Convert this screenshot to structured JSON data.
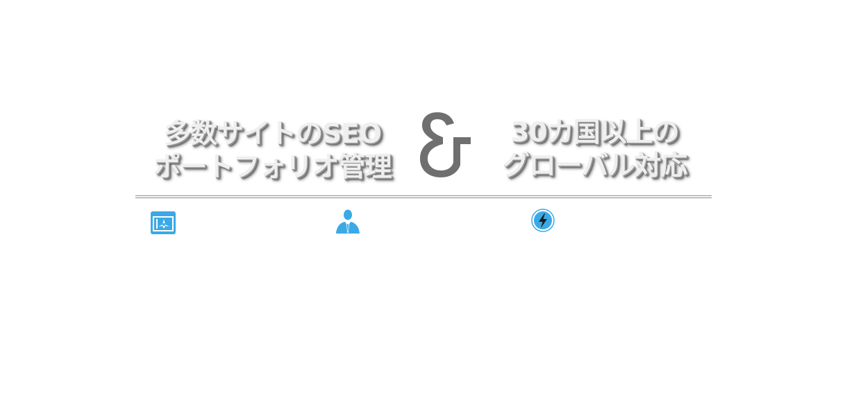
{
  "headline": {
    "left_line_1": "多数サイトのSEO",
    "left_line_2": "ポートフォリオ管理",
    "ampersand": "&",
    "right_line_1": "30カ国以上の",
    "right_line_2": "グローバル対応"
  },
  "features": [
    {
      "icon": "portfolio-board-icon"
    },
    {
      "icon": "business-person-icon"
    },
    {
      "icon": "lightning-bolt-icon"
    }
  ],
  "colors": {
    "title_text": "#efefef",
    "title_shadow": "#555555",
    "ampersand": "#6f6f6f",
    "divider": "#8c8c8c",
    "icon_blue": "#3aa9e6"
  }
}
